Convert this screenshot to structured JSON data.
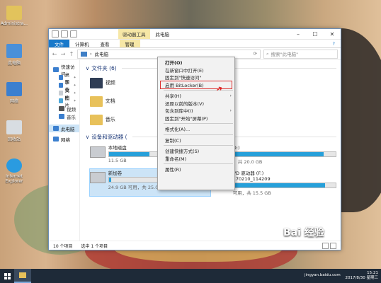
{
  "desktop": {
    "icons": [
      {
        "label": "Administra..."
      },
      {
        "label": "此电脑"
      },
      {
        "label": "网络"
      },
      {
        "label": "回收站"
      },
      {
        "label": "Internet Explorer"
      }
    ]
  },
  "window": {
    "context_tab": "驱动器工具",
    "title": "此电脑",
    "ribbon_tabs": [
      "文件",
      "计算机",
      "查看",
      "管理"
    ],
    "address_path": "此电脑",
    "search_placeholder": "搜索\"此电脑\"",
    "sidebar": [
      {
        "label": "快速访问",
        "level": 0
      },
      {
        "label": "桌面",
        "level": 1,
        "pinned": true
      },
      {
        "label": "下载",
        "level": 1,
        "pinned": true
      },
      {
        "label": "文档",
        "level": 1,
        "pinned": true
      },
      {
        "label": "图片",
        "level": 1,
        "pinned": true
      },
      {
        "label": "视频",
        "level": 1
      },
      {
        "label": "音乐",
        "level": 1
      },
      {
        "label": "此电脑",
        "level": 0,
        "selected": true
      },
      {
        "label": "网络",
        "level": 0
      }
    ],
    "folders_heading": "文件夹 (6)",
    "folders": [
      {
        "label": "视频"
      },
      {
        "label": "文档"
      },
      {
        "label": "音乐"
      }
    ],
    "devices_heading": "设备和驱动器 (",
    "drives": [
      {
        "label": "本地磁盘",
        "space": "11.5 GB",
        "used_fraction": 0.4
      },
      {
        "label": "新加卷",
        "space": "24.9 GB 可用，共 25.0 GB",
        "used_fraction": 0.02,
        "selected": true
      }
    ],
    "drives_right": [
      {
        "label": "地磁盘 (D:)",
        "space": "GB 可用，共 20.0 GB",
        "used_fraction": 0.9
      },
      {
        "label": "VD 驱动器 (F:)",
        "sub": "170210_114209",
        "space": "可用，共 15.5 GB",
        "used_fraction": 0.9,
        "badge": "DVD-ROM"
      }
    ],
    "status_items": "10 个项目",
    "status_selected": "选中 1 个项目"
  },
  "context_menu": {
    "items": [
      {
        "label": "打开(O)",
        "bold": true
      },
      {
        "label": "在新窗口中打开(E)"
      },
      {
        "label": "固定到\"快速访问\""
      },
      {
        "label": "启用 BitLocker(B)",
        "highlight": true
      },
      {
        "sep": true
      },
      {
        "label": "共享(H)",
        "submenu": true
      },
      {
        "label": "还原以前的版本(V)"
      },
      {
        "label": "包含到库中(I)",
        "submenu": true
      },
      {
        "label": "固定到\"开始\"屏幕(P)"
      },
      {
        "sep": true
      },
      {
        "label": "格式化(A)..."
      },
      {
        "sep": true
      },
      {
        "label": "复制(C)"
      },
      {
        "sep": true
      },
      {
        "label": "创建快捷方式(S)"
      },
      {
        "label": "重命名(M)"
      },
      {
        "sep": true
      },
      {
        "label": "属性(R)"
      }
    ]
  },
  "taskbar": {
    "clock_time": "15:21",
    "clock_date": "2017/8/30 星期三"
  },
  "watermark": {
    "brand": "Bai 经验",
    "url": "jingyan.baidu.com"
  }
}
